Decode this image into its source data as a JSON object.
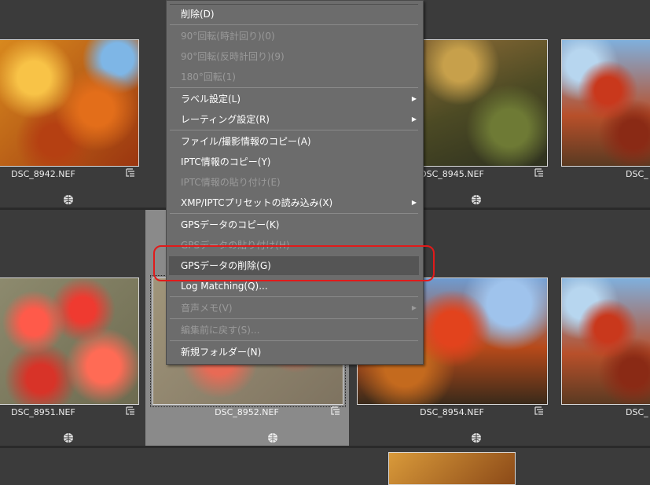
{
  "thumbnails": [
    {
      "name": "DSC_8942.NEF"
    },
    {
      "name": "DSC_8945.NEF"
    },
    {
      "name": "DSC_"
    },
    {
      "name": "DSC_8951.NEF"
    },
    {
      "name": "DSC_8952.NEF"
    },
    {
      "name": "DSC_8954.NEF"
    },
    {
      "name": "DSC_"
    }
  ],
  "menu": {
    "items": [
      {
        "label": "削除(D)"
      },
      {
        "label": "90°回転(時計回り)(0)"
      },
      {
        "label": "90°回転(反時計回り)(9)"
      },
      {
        "label": "180°回転(1)"
      },
      {
        "label": "ラベル設定(L)"
      },
      {
        "label": "レーティング設定(R)"
      },
      {
        "label": "ファイル/撮影情報のコピー(A)"
      },
      {
        "label": "IPTC情報のコピー(Y)"
      },
      {
        "label": "IPTC情報の貼り付け(E)"
      },
      {
        "label": "XMP/IPTCプリセットの読み込み(X)"
      },
      {
        "label": "GPSデータのコピー(K)"
      },
      {
        "label": "GPSデータの貼り付け(H)"
      },
      {
        "label": "GPSデータの削除(G)"
      },
      {
        "label": "Log Matching(Q)..."
      },
      {
        "label": "音声メモ(V)"
      },
      {
        "label": "編集前に戻す(S)..."
      },
      {
        "label": "新規フォルダー(N)"
      }
    ]
  },
  "colors": {
    "background": "#3b3b3b",
    "menu_background": "#6c6c6c",
    "highlight": "#555555",
    "annotation": "#e11a1a",
    "selected_cell": "#8a8a8a"
  },
  "icons": [
    "meta-info-icon",
    "globe-icon",
    "submenu-arrow-icon"
  ]
}
